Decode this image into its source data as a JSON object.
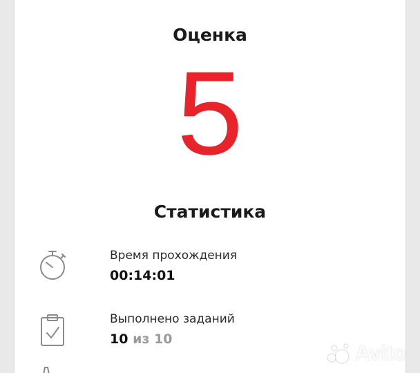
{
  "grade": {
    "title": "Оценка",
    "value": "5",
    "color": "#e8242a"
  },
  "statistics": {
    "title": "Статистика",
    "items": [
      {
        "icon": "stopwatch-icon",
        "label": "Время прохождения",
        "value": "00:14:01"
      },
      {
        "icon": "clipboard-check-icon",
        "label": "Выполнено заданий",
        "value_done": "10",
        "value_sep": "из",
        "value_total": "10"
      }
    ]
  },
  "watermark": {
    "text": "Avito"
  },
  "colors": {
    "accent": "#e8242a",
    "icon_stroke": "#8a8a8a"
  }
}
